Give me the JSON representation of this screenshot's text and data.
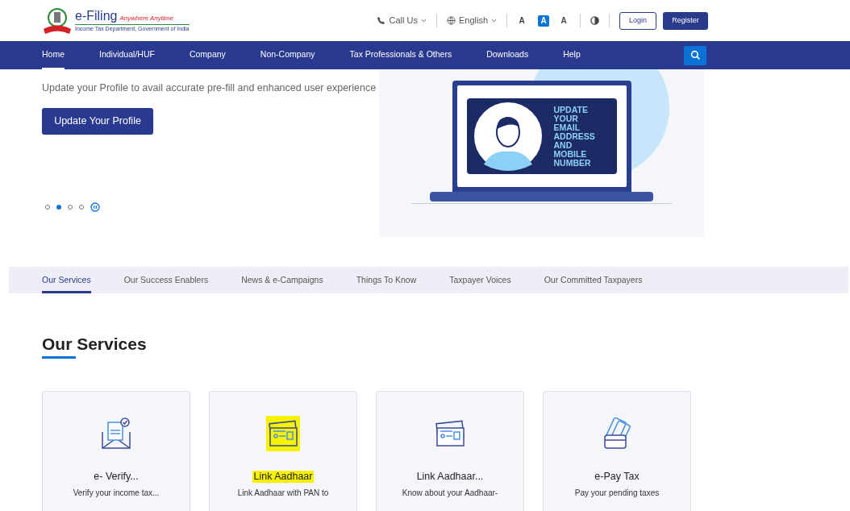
{
  "header": {
    "logo": {
      "title": "e-Filing",
      "tagline": "Anywhere Anytime",
      "subtitle": "Income Tax Department, Government of India"
    },
    "call_us": "Call Us",
    "language": "English",
    "font_sizes": [
      {
        "label": "A",
        "kind": "decrease",
        "selected": false
      },
      {
        "label": "A",
        "kind": "normal",
        "selected": true
      },
      {
        "label": "A",
        "kind": "increase",
        "selected": false
      }
    ],
    "login": "Login",
    "register": "Register"
  },
  "nav": {
    "items": [
      {
        "label": "Home",
        "selected": true
      },
      {
        "label": "Individual/HUF",
        "selected": false
      },
      {
        "label": "Company",
        "selected": false
      },
      {
        "label": "Non-Company",
        "selected": false
      },
      {
        "label": "Tax Professionals & Others",
        "selected": false
      },
      {
        "label": "Downloads",
        "selected": false
      },
      {
        "label": "Help",
        "selected": false
      }
    ]
  },
  "hero": {
    "text": "Update your Profile to avail accurate pre-fill and enhanced user experience",
    "button": "Update Your Profile",
    "dots": [
      {
        "selected": false
      },
      {
        "selected": true
      },
      {
        "selected": false
      },
      {
        "selected": false
      }
    ],
    "illustration_text": [
      "UPDATE",
      "YOUR",
      "EMAIL",
      "ADDRESS",
      "AND",
      "MOBILE",
      "NUMBER"
    ]
  },
  "tabs": [
    {
      "label": "Our Services",
      "selected": true
    },
    {
      "label": "Our Success Enablers",
      "selected": false
    },
    {
      "label": "News & e-Campaigns",
      "selected": false
    },
    {
      "label": "Things To Know",
      "selected": false
    },
    {
      "label": "Taxpayer Voices",
      "selected": false
    },
    {
      "label": "Our Committed Taxpayers",
      "selected": false
    }
  ],
  "section_title": "Our Services",
  "cards": [
    {
      "kind": "verify",
      "title": "e- Verify...",
      "description": "Verify your income tax...",
      "highlighted": false
    },
    {
      "kind": "card",
      "title": "Link Aadhaar",
      "description": "Link Aadhaar with PAN to",
      "highlighted": true
    },
    {
      "kind": "card",
      "title": "Link Aadhaar...",
      "description": "Know about your Aadhaar-",
      "highlighted": false
    },
    {
      "kind": "wallet",
      "title": "e-Pay Tax",
      "description": "Pay your pending taxes",
      "highlighted": false
    }
  ]
}
